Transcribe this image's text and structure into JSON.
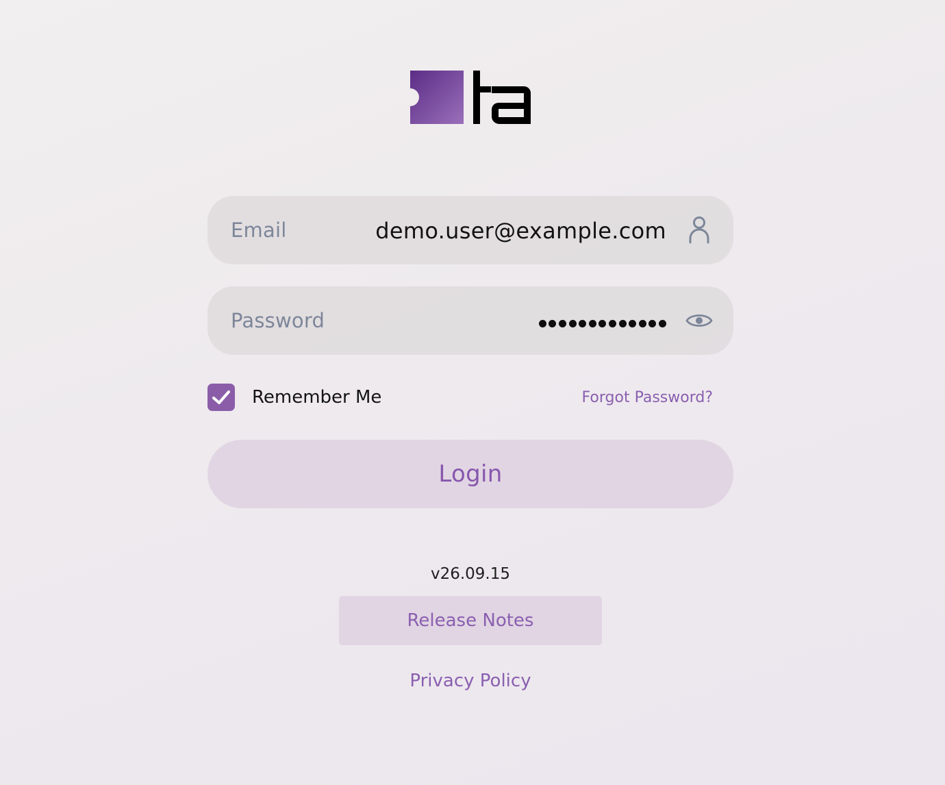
{
  "logo": {
    "text": "ta",
    "mark_color_start": "#5b2d86",
    "mark_color_end": "#9a6fba"
  },
  "form": {
    "email": {
      "label": "Email",
      "value": "demo.user@example.com",
      "icon": "user-icon"
    },
    "password": {
      "label": "Password",
      "masked_length": 13,
      "icon": "eye-icon"
    },
    "remember_me": {
      "label": "Remember Me",
      "checked": true
    },
    "forgot_password": "Forgot Password?",
    "login_label": "Login"
  },
  "footer": {
    "version": "v26.09.15",
    "release_notes_label": "Release Notes",
    "privacy_policy_label": "Privacy Policy"
  },
  "colors": {
    "accent": "#8a5fb0",
    "checkbox": "#8b5da8",
    "label": "#7d8699",
    "field_background": "#dedadd",
    "button_background": "#dfd3e2"
  }
}
